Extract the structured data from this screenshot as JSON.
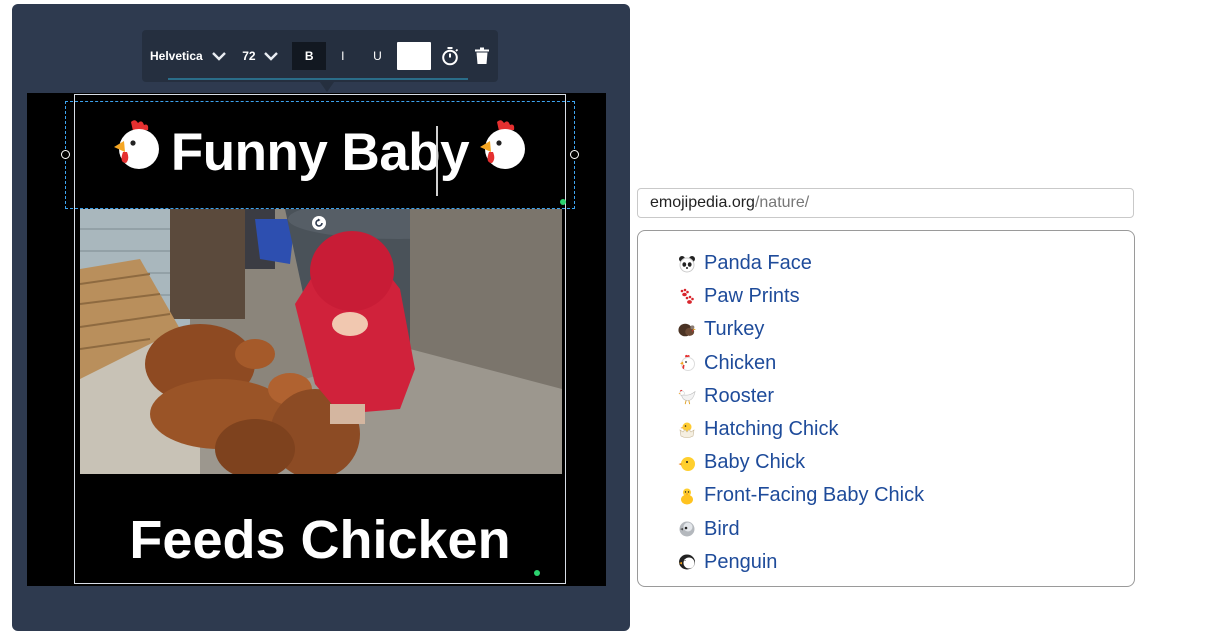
{
  "toolbar": {
    "font_name": "Helvetica",
    "font_size": "72",
    "bold_label": "B",
    "italic_label": "I",
    "underline_label": "U",
    "text_color": "#ffffff"
  },
  "canvas": {
    "top_caption": "Funny Baby",
    "bottom_caption": "Feeds Chicken",
    "caption_emoji": "chicken-icon"
  },
  "browser": {
    "url_host": "emojipedia.org",
    "url_path": "/nature/"
  },
  "emoji_list": [
    {
      "label": "Panda Face",
      "icon": "panda-face-icon"
    },
    {
      "label": "Paw Prints",
      "icon": "paw-prints-icon"
    },
    {
      "label": "Turkey",
      "icon": "turkey-icon"
    },
    {
      "label": "Chicken",
      "icon": "chicken-icon"
    },
    {
      "label": "Rooster",
      "icon": "rooster-icon"
    },
    {
      "label": "Hatching Chick",
      "icon": "hatching-chick-icon"
    },
    {
      "label": "Baby Chick",
      "icon": "baby-chick-icon"
    },
    {
      "label": "Front-Facing Baby Chick",
      "icon": "front-facing-baby-chick-icon"
    },
    {
      "label": "Bird",
      "icon": "bird-icon"
    },
    {
      "label": "Penguin",
      "icon": "penguin-icon"
    }
  ]
}
